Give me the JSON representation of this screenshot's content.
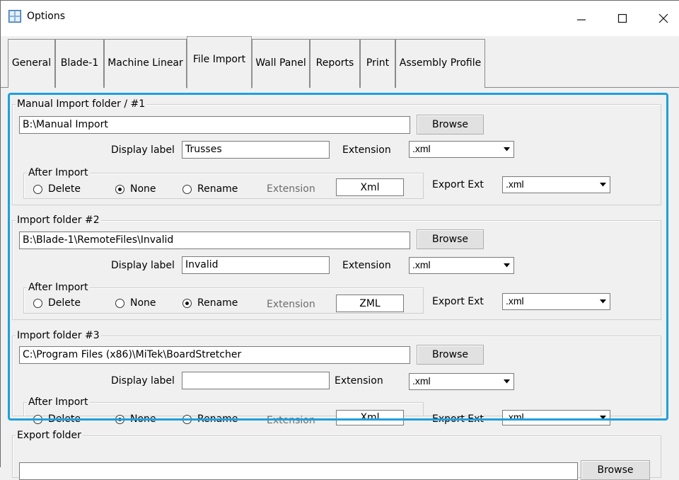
{
  "window": {
    "title": "Options"
  },
  "titlebar": {
    "min": "—",
    "max": "☐",
    "close": "✕"
  },
  "tabs": [
    "General",
    "Blade-1",
    "Machine Linear",
    "File Import",
    "Wall Panel",
    "Reports",
    "Print",
    "Assembly Profile"
  ],
  "active_tab": "File Import",
  "common": {
    "browse": "Browse",
    "display_label": "Display label",
    "extension": "Extension",
    "after_import": "After Import",
    "delete": "Delete",
    "none": "None",
    "rename": "Rename",
    "export_ext": "Export Ext"
  },
  "folders": [
    {
      "title": "Manual Import folder / #1",
      "path": "B:\\Manual Import",
      "display_label_value": "Trusses",
      "extension": ".xml",
      "after_import_selected": "None",
      "rename_extension": "Xml",
      "export_ext": ".xml"
    },
    {
      "title": "Import folder #2",
      "path": "B:\\Blade-1\\RemoteFiles\\Invalid",
      "display_label_value": "Invalid",
      "extension": ".xml",
      "after_import_selected": "Rename",
      "rename_extension": "ZML",
      "export_ext": ".xml"
    },
    {
      "title": "Import folder #3",
      "path": "C:\\Program Files (x86)\\MiTek\\BoardStretcher",
      "display_label_value": "",
      "extension": ".xml",
      "after_import_selected": "None",
      "rename_extension": "Xml",
      "export_ext": ".xml"
    }
  ],
  "export_folder": {
    "title": "Export folder",
    "browse": "Browse"
  },
  "colors": {
    "highlight": "#1ea0dc",
    "background": "#f0f0f0"
  }
}
